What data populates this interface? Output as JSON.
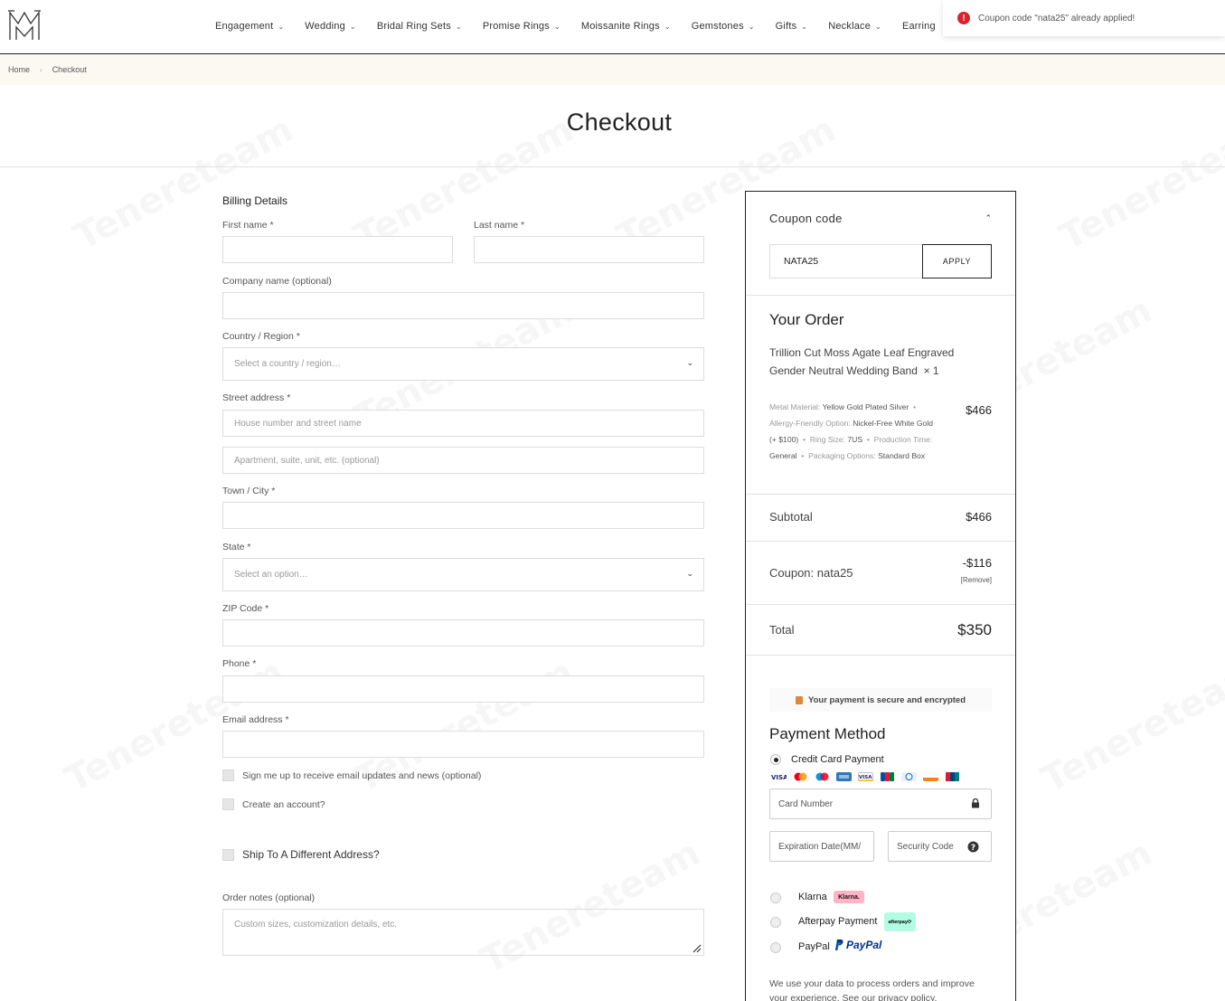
{
  "header": {
    "nav": [
      {
        "label": "Engagement",
        "chevron": true
      },
      {
        "label": "Wedding",
        "chevron": true
      },
      {
        "label": "Bridal Ring Sets",
        "chevron": true
      },
      {
        "label": "Promise Rings",
        "chevron": true
      },
      {
        "label": "Moissanite Rings",
        "chevron": true
      },
      {
        "label": "Gemstones",
        "chevron": true
      },
      {
        "label": "Gifts",
        "chevron": true
      },
      {
        "label": "Necklace",
        "chevron": true
      },
      {
        "label": "Earring",
        "chevron": false
      }
    ],
    "toast": "Coupon code \"nata25\" already applied!"
  },
  "breadcrumb": {
    "home": "Home",
    "current": "Checkout"
  },
  "page_title": "Checkout",
  "billing": {
    "heading": "Billing Details",
    "first_name": "First name *",
    "last_name": "Last name *",
    "company": "Company name (optional)",
    "country": "Country / Region *",
    "country_placeholder": "Select a country / region…",
    "street": "Street address *",
    "street_placeholder": "House number and street name",
    "apt_placeholder": "Apartment, suite, unit, etc. (optional)",
    "city": "Town / City *",
    "state": "State *",
    "state_placeholder": "Select an option…",
    "zip": "ZIP Code *",
    "phone": "Phone *",
    "email": "Email address *",
    "signup": "Sign me up to receive email updates and news (optional)",
    "create_account": "Create an account?",
    "ship_different": "Ship To A Different Address?",
    "notes": "Order notes (optional)",
    "notes_placeholder": "Custom sizes, customization details, etc."
  },
  "order": {
    "coupon_title": "Coupon code",
    "coupon_value": "NATA25",
    "apply": "APPLY",
    "title": "Your Order",
    "product_name": "Trillion Cut Moss Agate Leaf Engraved Gender Neutral Wedding Band",
    "quantity": "× 1",
    "meta": {
      "metal_label": "Metal Material:",
      "metal": "Yellow Gold Plated Silver",
      "allergy_label": "Allergy-Friendly Option:",
      "allergy": "Nickel-Free White Gold (+ $100)",
      "ring_label": "Ring Size:",
      "ring": "7US",
      "production_label": "Production Time:",
      "production": "General",
      "packaging_label": "Packaging Options:",
      "packaging": "Standard Box"
    },
    "product_price": "$466",
    "subtotal_label": "Subtotal",
    "subtotal": "$466",
    "coupon_label": "Coupon: nata25",
    "coupon_amount": "-$116",
    "remove": "[Remove]",
    "total_label": "Total",
    "total": "$350",
    "secure": "Your payment is secure and encrypted",
    "payment_title": "Payment Method",
    "credit_card": "Credit Card Payment",
    "card_number": "Card Number",
    "expiration": "Expiration Date(MM/",
    "security_code": "Security Code",
    "klarna": "Klarna",
    "klarna_badge": "Klarna.",
    "afterpay": "Afterpay Payment",
    "afterpay_badge": "afterpay⟳",
    "paypal": "PayPal",
    "paypal_logo": "PayPal",
    "privacy": "We use your data to process orders and improve your experience. See our privacy policy."
  },
  "colors": {
    "accent": "#222222",
    "breadcrumb_bg": "#fbf9f1",
    "error": "#d9232d",
    "klarna": "#ffb3c7",
    "afterpay": "#b2fce4",
    "paypal": "#003087"
  },
  "watermark": "Tenereteam"
}
